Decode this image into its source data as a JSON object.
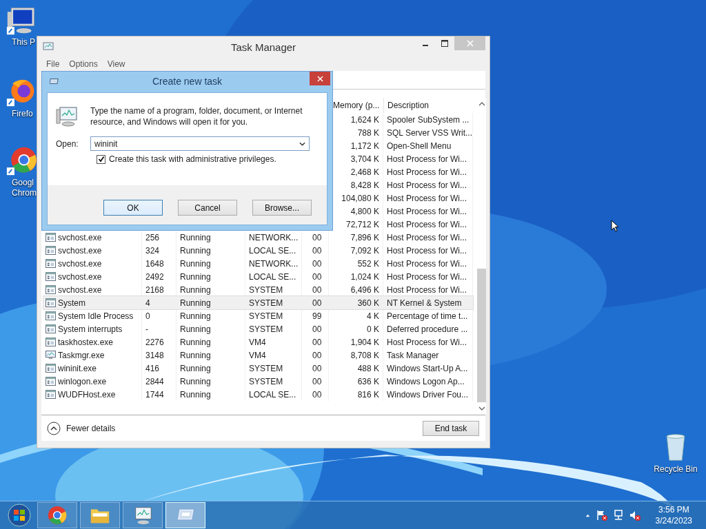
{
  "desktop_icons": [
    {
      "label": "This P",
      "kind": "pc"
    },
    {
      "label": "Firefo",
      "kind": "firefox"
    },
    {
      "label": "Googl Chrom",
      "kind": "chrome"
    },
    {
      "label": "Recycle Bin",
      "kind": "bin"
    }
  ],
  "task_manager": {
    "title": "Task Manager",
    "menu": [
      "File",
      "Options",
      "View"
    ],
    "columns": [
      {
        "label": "Memory (p..."
      },
      {
        "label": "Description"
      }
    ],
    "rows": [
      {
        "memory": "1,624 K",
        "description": "Spooler SubSystem ...",
        "selected": false
      },
      {
        "memory": "788 K",
        "description": "SQL Server VSS Writ...",
        "selected": false
      },
      {
        "memory": "1,172 K",
        "description": "Open-Shell Menu",
        "selected": false
      },
      {
        "memory": "3,704 K",
        "description": "Host Process for Wi...",
        "selected": false
      },
      {
        "memory": "2,468 K",
        "description": "Host Process for Wi...",
        "selected": false
      },
      {
        "memory": "8,428 K",
        "description": "Host Process for Wi...",
        "selected": false
      },
      {
        "memory": "104,080 K",
        "description": "Host Process for Wi...",
        "selected": false
      },
      {
        "memory": "4,800 K",
        "description": "Host Process for Wi...",
        "selected": false
      },
      {
        "memory": "72,712 K",
        "description": "Host Process for Wi...",
        "selected": false
      },
      {
        "kind": "app",
        "name": "svchost.exe",
        "pid": "256",
        "status": "Running",
        "user": "NETWORK...",
        "cpu": "00",
        "memory": "7,896 K",
        "description": "Host Process for Wi...",
        "selected": false
      },
      {
        "kind": "app",
        "name": "svchost.exe",
        "pid": "324",
        "status": "Running",
        "user": "LOCAL SE...",
        "cpu": "00",
        "memory": "7,092 K",
        "description": "Host Process for Wi...",
        "selected": false
      },
      {
        "kind": "app",
        "name": "svchost.exe",
        "pid": "1648",
        "status": "Running",
        "user": "NETWORK...",
        "cpu": "00",
        "memory": "552 K",
        "description": "Host Process for Wi...",
        "selected": false
      },
      {
        "kind": "app",
        "name": "svchost.exe",
        "pid": "2492",
        "status": "Running",
        "user": "LOCAL SE...",
        "cpu": "00",
        "memory": "1,024 K",
        "description": "Host Process for Wi...",
        "selected": false
      },
      {
        "kind": "app",
        "name": "svchost.exe",
        "pid": "2168",
        "status": "Running",
        "user": "SYSTEM",
        "cpu": "00",
        "memory": "6,496 K",
        "description": "Host Process for Wi...",
        "selected": false
      },
      {
        "kind": "app",
        "name": "System",
        "pid": "4",
        "status": "Running",
        "user": "SYSTEM",
        "cpu": "00",
        "memory": "360 K",
        "description": "NT Kernel & System",
        "selected": true
      },
      {
        "kind": "app",
        "name": "System Idle Process",
        "pid": "0",
        "status": "Running",
        "user": "SYSTEM",
        "cpu": "99",
        "memory": "4 K",
        "description": "Percentage of time t...",
        "selected": false
      },
      {
        "kind": "app",
        "name": "System interrupts",
        "pid": "-",
        "status": "Running",
        "user": "SYSTEM",
        "cpu": "00",
        "memory": "0 K",
        "description": "Deferred procedure ...",
        "selected": false
      },
      {
        "kind": "app",
        "name": "taskhostex.exe",
        "pid": "2276",
        "status": "Running",
        "user": "VM4",
        "cpu": "00",
        "memory": "1,904 K",
        "description": "Host Process for Wi...",
        "selected": false
      },
      {
        "kind": "monitor",
        "name": "Taskmgr.exe",
        "pid": "3148",
        "status": "Running",
        "user": "VM4",
        "cpu": "00",
        "memory": "8,708 K",
        "description": "Task Manager",
        "selected": false
      },
      {
        "kind": "app",
        "name": "wininit.exe",
        "pid": "416",
        "status": "Running",
        "user": "SYSTEM",
        "cpu": "00",
        "memory": "488 K",
        "description": "Windows Start-Up A...",
        "selected": false
      },
      {
        "kind": "app",
        "name": "winlogon.exe",
        "pid": "2844",
        "status": "Running",
        "user": "SYSTEM",
        "cpu": "00",
        "memory": "636 K",
        "description": "Windows Logon Ap...",
        "selected": false
      },
      {
        "kind": "app",
        "name": "WUDFHost.exe",
        "pid": "1744",
        "status": "Running",
        "user": "LOCAL SE...",
        "cpu": "00",
        "memory": "816 K",
        "description": "Windows Driver Fou...",
        "selected": false
      }
    ],
    "fewer_details": "Fewer details",
    "end_task": "End task"
  },
  "dialog": {
    "title": "Create new task",
    "message": "Type the name of a program, folder, document, or Internet resource, and Windows will open it for you.",
    "open_label": "Open:",
    "open_value": "wininit",
    "admin_checkbox": {
      "label": "Create this task with administrative privileges.",
      "checked": true
    },
    "buttons": [
      {
        "label": "OK",
        "default": true
      },
      {
        "label": "Cancel",
        "default": false
      },
      {
        "label": "Browse...",
        "default": false
      }
    ]
  },
  "taskbar": {
    "apps": [
      {
        "kind": "chrome",
        "active": false
      },
      {
        "kind": "explorer",
        "active": false
      },
      {
        "kind": "monitor",
        "active": false
      },
      {
        "kind": "dialog",
        "active": true
      }
    ],
    "time": "3:56 PM",
    "date": "3/24/2023"
  }
}
